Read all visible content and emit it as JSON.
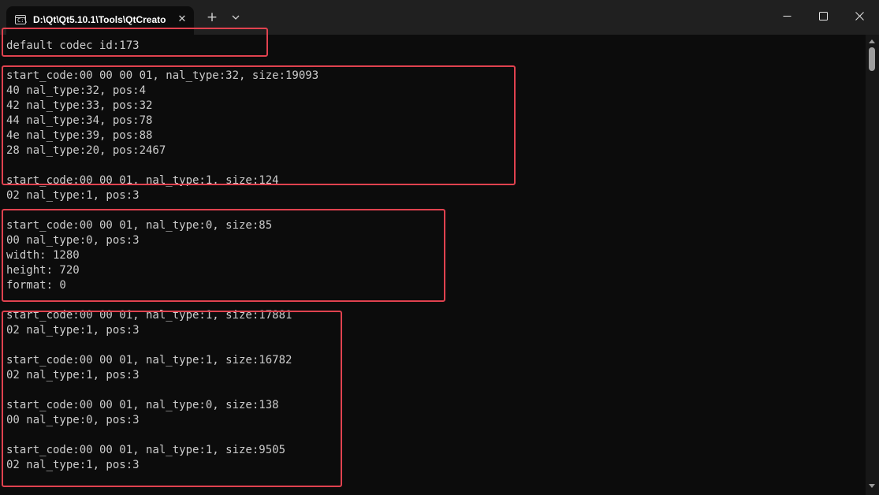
{
  "titlebar": {
    "tab_title": "D:\\Qt\\Qt5.10.1\\Tools\\QtCreato",
    "tab_icon": "terminal-icon",
    "tab_icon_prompt": "C:\\",
    "close_tab_glyph": "✕",
    "new_tab_glyph": "+",
    "dropdown_icon": "chevron-down-icon",
    "minimize_icon": "minimize-icon",
    "maximize_icon": "maximize-icon",
    "close_icon": "close-icon"
  },
  "console": {
    "lines": [
      "default codec id:173",
      "",
      "start_code:00 00 00 01, nal_type:32, size:19093",
      "40 nal_type:32, pos:4",
      "42 nal_type:33, pos:32",
      "44 nal_type:34, pos:78",
      "4e nal_type:39, pos:88",
      "28 nal_type:20, pos:2467",
      "",
      "start_code:00 00 01, nal_type:1, size:124",
      "02 nal_type:1, pos:3",
      "",
      "start_code:00 00 01, nal_type:0, size:85",
      "00 nal_type:0, pos:3",
      "width: 1280",
      "height: 720",
      "format: 0",
      "",
      "start_code:00 00 01, nal_type:1, size:17881",
      "02 nal_type:1, pos:3",
      "",
      "start_code:00 00 01, nal_type:1, size:16782",
      "02 nal_type:1, pos:3",
      "",
      "start_code:00 00 01, nal_type:0, size:138",
      "00 nal_type:0, pos:3",
      "",
      "start_code:00 00 01, nal_type:1, size:9505",
      "02 nal_type:1, pos:3"
    ]
  },
  "colors": {
    "background": "#0c0c0c",
    "titlebar": "#202020",
    "text": "#cccccc",
    "highlight": "#e0424f"
  }
}
